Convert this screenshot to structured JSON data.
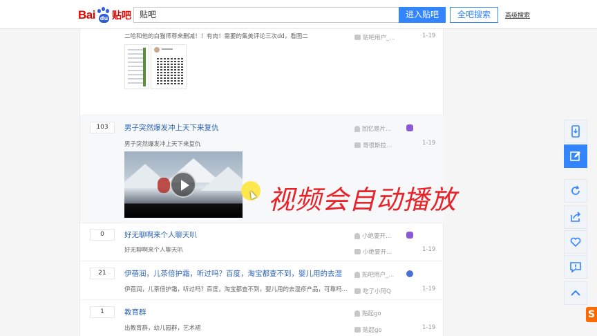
{
  "header": {
    "logo_bai": "Bai",
    "logo_du": "du",
    "logo_tieba": "贴吧",
    "search_value": "贴吧",
    "enter_button": "进入贴吧",
    "all_search_button": "全吧搜索",
    "advanced_link": "高级搜索"
  },
  "threads": [
    {
      "reply_count": "",
      "title": "",
      "abstract": "二哈和他的白猫师尊来删减！！有肉！需要的集美评论三次dd，看图二",
      "author_top": "",
      "author_last": "贴吧用户_...",
      "date": "1-19"
    },
    {
      "reply_count": "103",
      "title": "男子突然爆发冲上天下来复仇",
      "abstract": "男子突然爆发冲上天下来复仇",
      "author_top": "回忆是片...",
      "author_last": "哥很斯拉...",
      "date": "1-19"
    },
    {
      "reply_count": "0",
      "title": "好无聊啊来个人聊天叭",
      "abstract": "好无聊啊来个人聊天叭",
      "author_top": "小绝要开...",
      "author_last": "小绝要开...",
      "date": "1-19"
    },
    {
      "reply_count": "21",
      "title": "伊蓓润，儿茶倍护霜，听过吗？百度，淘宝都查不到，婴儿用的去湿",
      "abstract": "伊蓓润，儿茶倍护霜，听过吗？百度，淘宝都查不到，婴儿用的去湿疹产品，可靠吗...",
      "author_top": "贴吧用户_...",
      "author_last": "吃了小阿Q",
      "date": "1-19"
    },
    {
      "reply_count": "1",
      "title": "教育群",
      "abstract": "出教育群，幼儿园群，艺术裙",
      "author_top": "贴起go",
      "author_last": "贴起go",
      "date": "1-19"
    }
  ],
  "overlay_caption": "视频会自动播放",
  "sidebar_icons": [
    "phone-icon",
    "edit-icon",
    "refresh-icon",
    "share-icon",
    "favorite-icon",
    "report-icon",
    "back-to-top-icon"
  ],
  "colors": {
    "accent": "#3385ff",
    "link": "#2d64b3",
    "brand_red": "#e10602",
    "caption_red": "#e8232a"
  }
}
